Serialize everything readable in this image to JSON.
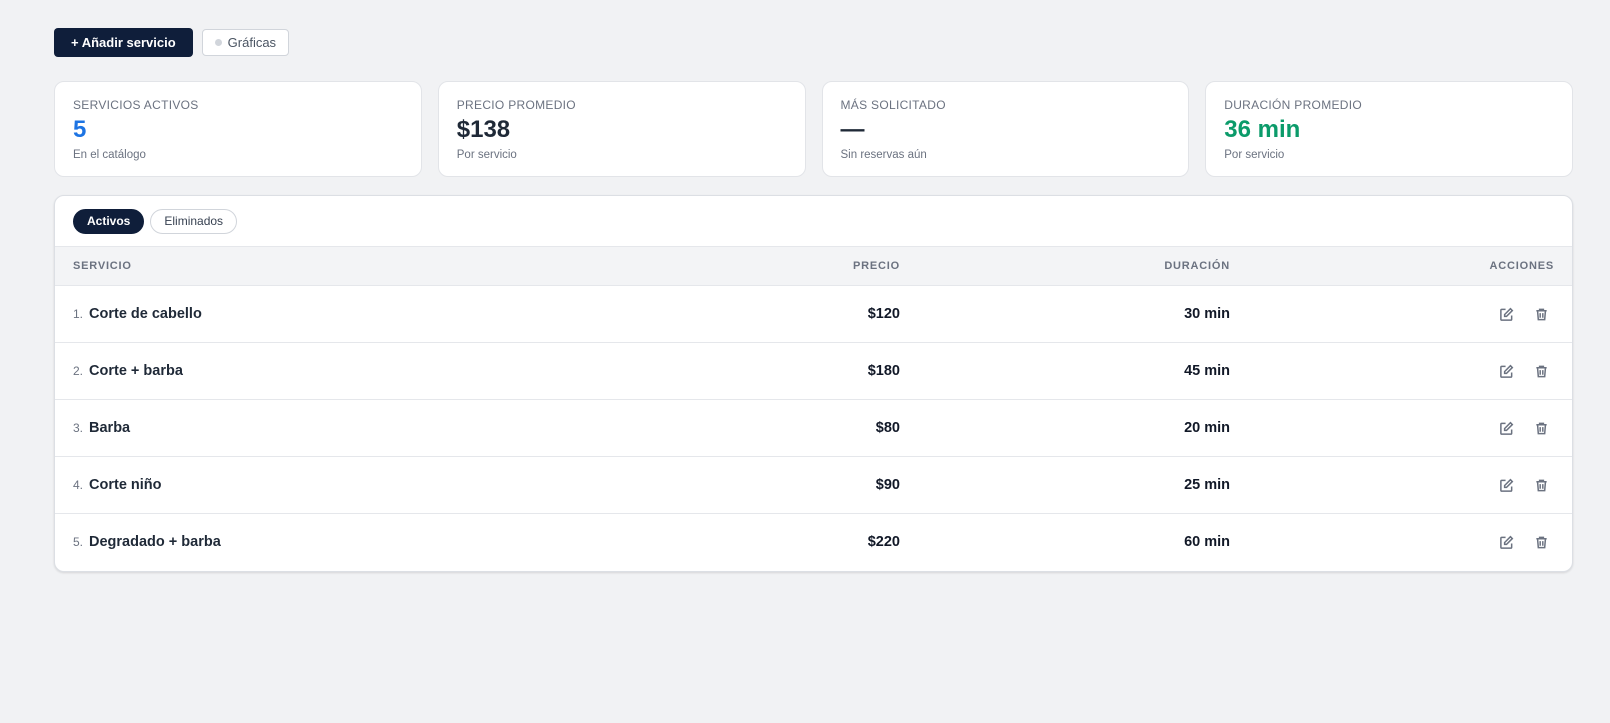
{
  "toolbar": {
    "add_label": "+ Añadir servicio",
    "charts_label": "Gráficas"
  },
  "stats": [
    {
      "label": "SERVICIOS ACTIVOS",
      "value": "5",
      "sub": "En el catálogo",
      "color": "#1d74e3"
    },
    {
      "label": "PRECIO PROMEDIO",
      "value": "$138",
      "sub": "Por servicio",
      "color": "#1f2937"
    },
    {
      "label": "MÁS SOLICITADO",
      "value": "—",
      "sub": "Sin reservas aún",
      "color": "#1f2937"
    },
    {
      "label": "DURACIÓN PROMEDIO",
      "value": "36 min",
      "sub": "Por servicio",
      "color": "#0b9b6a"
    }
  ],
  "tabs": [
    {
      "label": "Activos",
      "active": true
    },
    {
      "label": "Eliminados",
      "active": false
    }
  ],
  "table": {
    "headers": {
      "service": "SERVICIO",
      "price": "PRECIO",
      "duration": "DURACIÓN",
      "actions": "ACCIONES"
    },
    "rows": [
      {
        "num": "1.",
        "name": "Corte de cabello",
        "price": "$120",
        "duration": "30 min"
      },
      {
        "num": "2.",
        "name": "Corte + barba",
        "price": "$180",
        "duration": "45 min"
      },
      {
        "num": "3.",
        "name": "Barba",
        "price": "$80",
        "duration": "20 min"
      },
      {
        "num": "4.",
        "name": "Corte niño",
        "price": "$90",
        "duration": "25 min"
      },
      {
        "num": "5.",
        "name": "Degradado + barba",
        "price": "$220",
        "duration": "60 min"
      }
    ],
    "row_icons": [
      "edit-icon",
      "trash-icon"
    ]
  }
}
